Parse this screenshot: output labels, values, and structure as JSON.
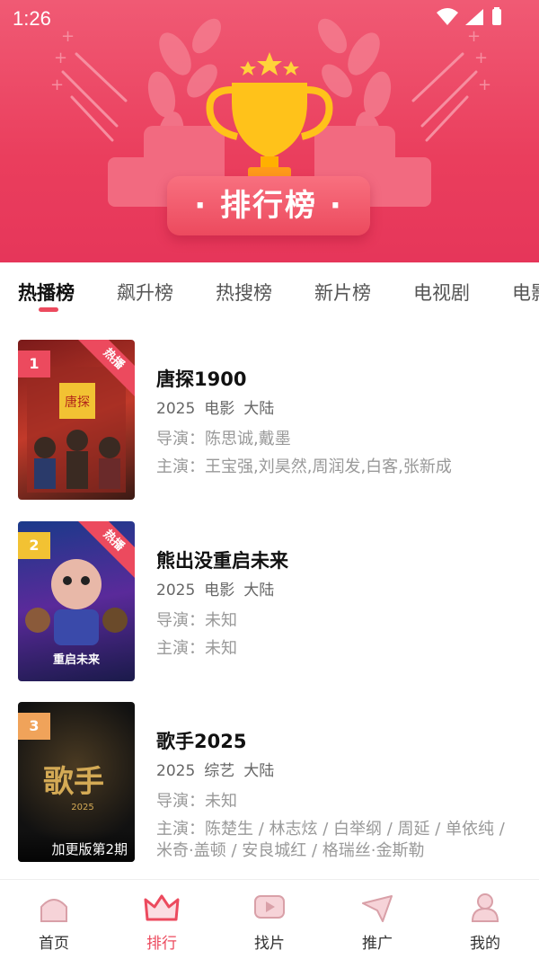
{
  "status_bar": {
    "time": "1:26"
  },
  "hero": {
    "title": "· 排行榜 ·"
  },
  "tabs": [
    {
      "label": "热播榜",
      "active": true
    },
    {
      "label": "飙升榜"
    },
    {
      "label": "热搜榜"
    },
    {
      "label": "新片榜"
    },
    {
      "label": "电视剧"
    },
    {
      "label": "电影"
    }
  ],
  "items": [
    {
      "rank": "1",
      "badge": "热播",
      "title": "唐探1900",
      "year": "2025",
      "type": "电影",
      "region": "大陆",
      "director": "导演：陈思诚,戴墨",
      "cast": "主演：王宝强,刘昊然,周润发,白客,张新成",
      "rank_color": "#ec4a5e"
    },
    {
      "rank": "2",
      "badge": "热播",
      "title": "熊出没重启未来",
      "year": "2025",
      "type": "电影",
      "region": "大陆",
      "director": "导演：未知",
      "cast": "主演：未知",
      "rank_color": "#f2c233"
    },
    {
      "rank": "3",
      "title": "歌手2025",
      "year": "2025",
      "type": "综艺",
      "region": "大陆",
      "director": "导演：未知",
      "cast": "主演：陈楚生 / 林志炫 / 白举纲 / 周延 / 单依纯 / 米奇·盖顿 / 安良城红 / 格瑞丝·金斯勒",
      "caption": "加更版第2期",
      "rank_color": "#f0a35a"
    }
  ],
  "bottom_nav": [
    {
      "label": "首页",
      "icon": "home-icon"
    },
    {
      "label": "排行",
      "icon": "crown-icon",
      "active": true
    },
    {
      "label": "找片",
      "icon": "play-icon"
    },
    {
      "label": "推广",
      "icon": "send-icon"
    },
    {
      "label": "我的",
      "icon": "user-icon"
    }
  ],
  "colors": {
    "accent": "#ec4a5e",
    "trophy": "#ffc21a"
  }
}
